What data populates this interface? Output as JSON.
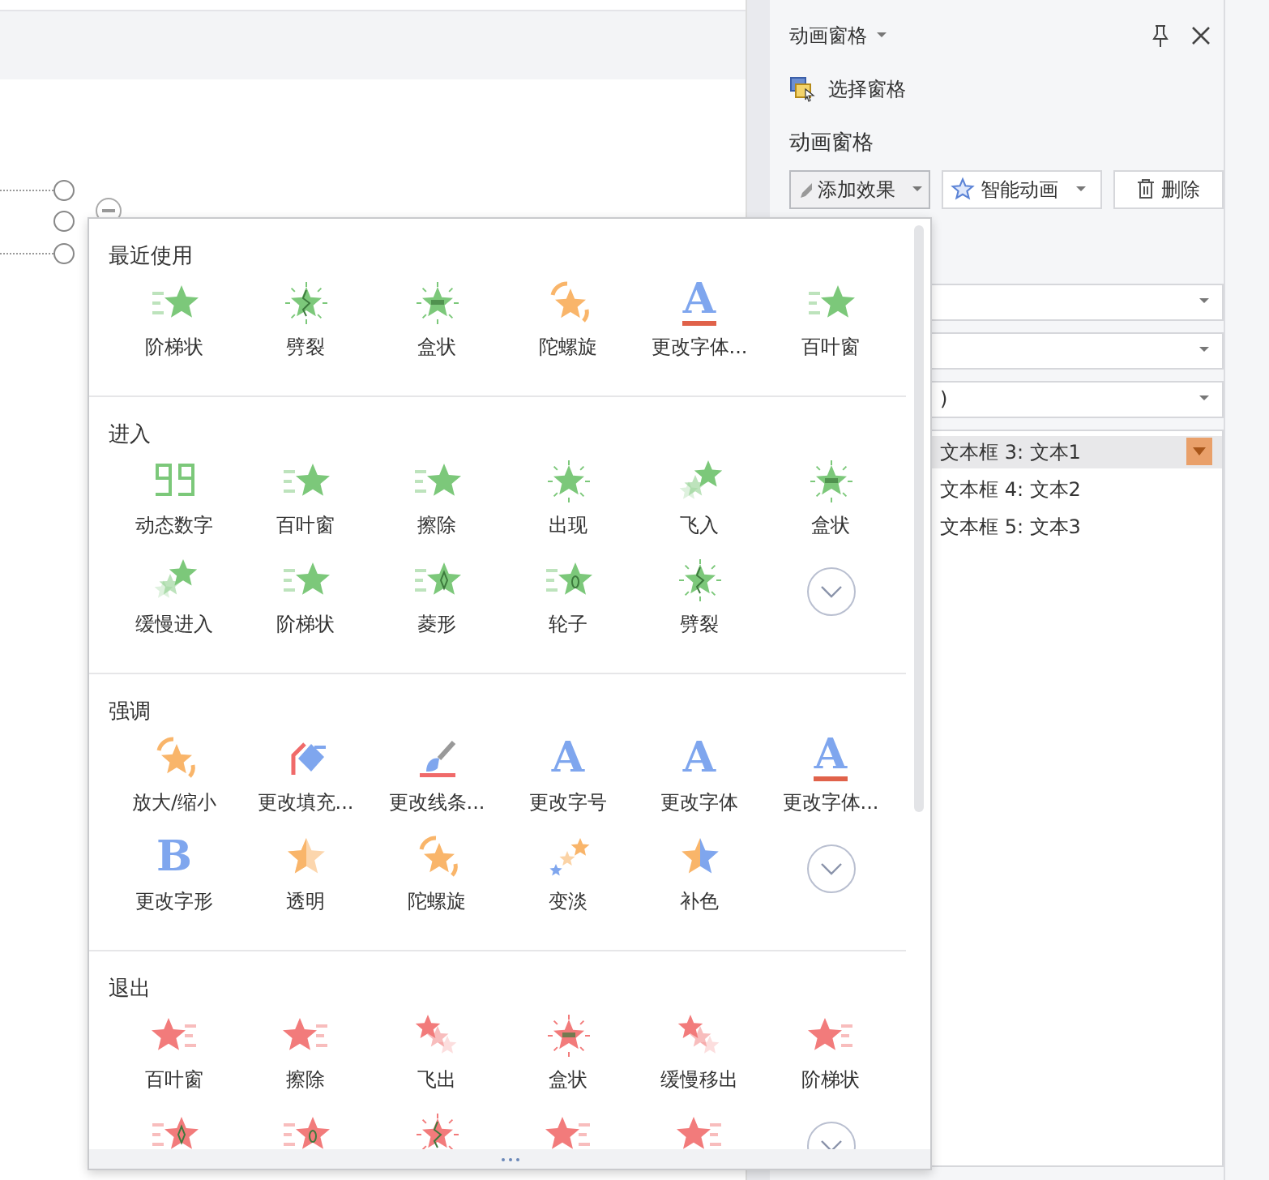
{
  "panel": {
    "title": "动画窗格",
    "select_pane": "选择窗格",
    "section_label": "动画窗格",
    "buttons": [
      {
        "kind": "add",
        "label": "添加效果",
        "pressed": true
      },
      {
        "kind": "smart",
        "label": "智能动画",
        "pressed": false
      },
      {
        "kind": "delete",
        "label": "删除",
        "pressed": false
      }
    ],
    "fields": [
      {
        "kind": "dropdown"
      },
      {
        "kind": "dropdown"
      },
      {
        "kind": "dropdown",
        "value": ")"
      }
    ],
    "list": [
      {
        "label": "文本框 3: 文本1",
        "selected": true
      },
      {
        "label": "文本框 4: 文本2",
        "selected": false
      },
      {
        "label": "文本框 5: 文本3",
        "selected": false
      }
    ]
  },
  "effects_menu": {
    "sections": [
      {
        "title": "最近使用",
        "items": [
          {
            "kind": "lines",
            "color": "#7cc87a",
            "label": "阶梯状"
          },
          {
            "kind": "burst-zigzag",
            "color": "#7cc87a",
            "label": "劈裂"
          },
          {
            "kind": "burst-box",
            "color": "#7cc87a",
            "label": "盒状"
          },
          {
            "kind": "swirl",
            "color": "#f9b56a",
            "label": "陀螺旋"
          },
          {
            "kind": "letter-underline",
            "color": "#7fa6ee",
            "glyph": "A",
            "label": "更改字体..."
          },
          {
            "kind": "lines",
            "color": "#7cc87a",
            "label": "百叶窗"
          }
        ]
      },
      {
        "title": "进入",
        "items": [
          {
            "kind": "digits",
            "color": "#7cc87a",
            "label": "动态数字"
          },
          {
            "kind": "lines",
            "color": "#7cc87a",
            "label": "百叶窗"
          },
          {
            "kind": "lines",
            "color": "#7cc87a",
            "label": "擦除"
          },
          {
            "kind": "burst",
            "color": "#7cc87a",
            "label": "出现"
          },
          {
            "kind": "fly",
            "color": "#7cc87a",
            "label": "飞入"
          },
          {
            "kind": "burst-box",
            "color": "#7cc87a",
            "label": "盒状"
          },
          {
            "kind": "fly",
            "color": "#7cc87a",
            "label": "缓慢进入"
          },
          {
            "kind": "lines",
            "color": "#7cc87a",
            "label": "阶梯状"
          },
          {
            "kind": "lines-diamond",
            "color": "#7cc87a",
            "label": "菱形"
          },
          {
            "kind": "lines-wheel",
            "color": "#7cc87a",
            "label": "轮子"
          },
          {
            "kind": "burst-zigzag",
            "color": "#7cc87a",
            "label": "劈裂"
          },
          {
            "kind": "more"
          }
        ]
      },
      {
        "title": "强调",
        "items": [
          {
            "kind": "swirl",
            "color": "#f9b56a",
            "label": "放大/缩小"
          },
          {
            "kind": "bucket",
            "color": "#7fa6ee",
            "label": "更改填充..."
          },
          {
            "kind": "brush",
            "color": "#7fa6ee",
            "label": "更改线条..."
          },
          {
            "kind": "letter",
            "color": "#7fa6ee",
            "glyph": "A",
            "label": "更改字号"
          },
          {
            "kind": "letter",
            "color": "#7fa6ee",
            "glyph": "A",
            "label": "更改字体"
          },
          {
            "kind": "letter-underline",
            "color": "#7fa6ee",
            "glyph": "A",
            "label": "更改字体..."
          },
          {
            "kind": "letter",
            "color": "#7fa6ee",
            "glyph": "B",
            "label": "更改字形"
          },
          {
            "kind": "half",
            "color": "#f9b56a",
            "label": "透明"
          },
          {
            "kind": "swirl",
            "color": "#f9b56a",
            "label": "陀螺旋"
          },
          {
            "kind": "fade",
            "color": "#f9b56a",
            "label": "变淡"
          },
          {
            "kind": "two-tone",
            "color": "#f9b56a",
            "label": "补色"
          },
          {
            "kind": "more"
          }
        ]
      },
      {
        "title": "退出",
        "items": [
          {
            "kind": "lines-right",
            "color": "#f27b7b",
            "label": "百叶窗"
          },
          {
            "kind": "lines-right",
            "color": "#f27b7b",
            "label": "擦除"
          },
          {
            "kind": "fly-out",
            "color": "#f27b7b",
            "label": "飞出"
          },
          {
            "kind": "burst-box",
            "color": "#f27b7b",
            "label": "盒状"
          },
          {
            "kind": "fly-out",
            "color": "#f27b7b",
            "label": "缓慢移出"
          },
          {
            "kind": "lines-right",
            "color": "#f27b7b",
            "label": "阶梯状"
          },
          {
            "kind": "lines-diamond",
            "color": "#f27b7b"
          },
          {
            "kind": "lines-wheel",
            "color": "#f27b7b"
          },
          {
            "kind": "burst-zigzag",
            "color": "#f27b7b"
          },
          {
            "kind": "lines-right",
            "color": "#f27b7b"
          },
          {
            "kind": "lines-right",
            "color": "#f27b7b"
          },
          {
            "kind": "more"
          }
        ]
      }
    ]
  }
}
